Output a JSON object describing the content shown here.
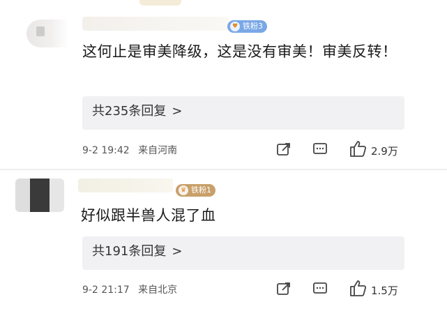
{
  "comments": [
    {
      "badge": "铁粉3",
      "content": "这何止是审美降级，这是没有审美！审美反转！",
      "replies_label": "共235条回复",
      "replies_arrow": ">",
      "time": "9-2 19:42",
      "location": "来自河南",
      "likes": "2.9万"
    },
    {
      "badge": "铁粉1",
      "content": "好似跟半兽人混了血",
      "replies_label": "共191条回复",
      "replies_arrow": ">",
      "time": "9-2 21:17",
      "location": "来自北京",
      "likes": "1.5万"
    }
  ],
  "icons": {
    "share": "share-icon",
    "comment": "comment-icon",
    "like": "thumbs-up-icon",
    "badge": "fan-badge-icon"
  },
  "colors": {
    "badge_blue": "#7aa8e6",
    "badge_gold": "#c8a06a",
    "reply_bg": "#f1f1f3"
  }
}
